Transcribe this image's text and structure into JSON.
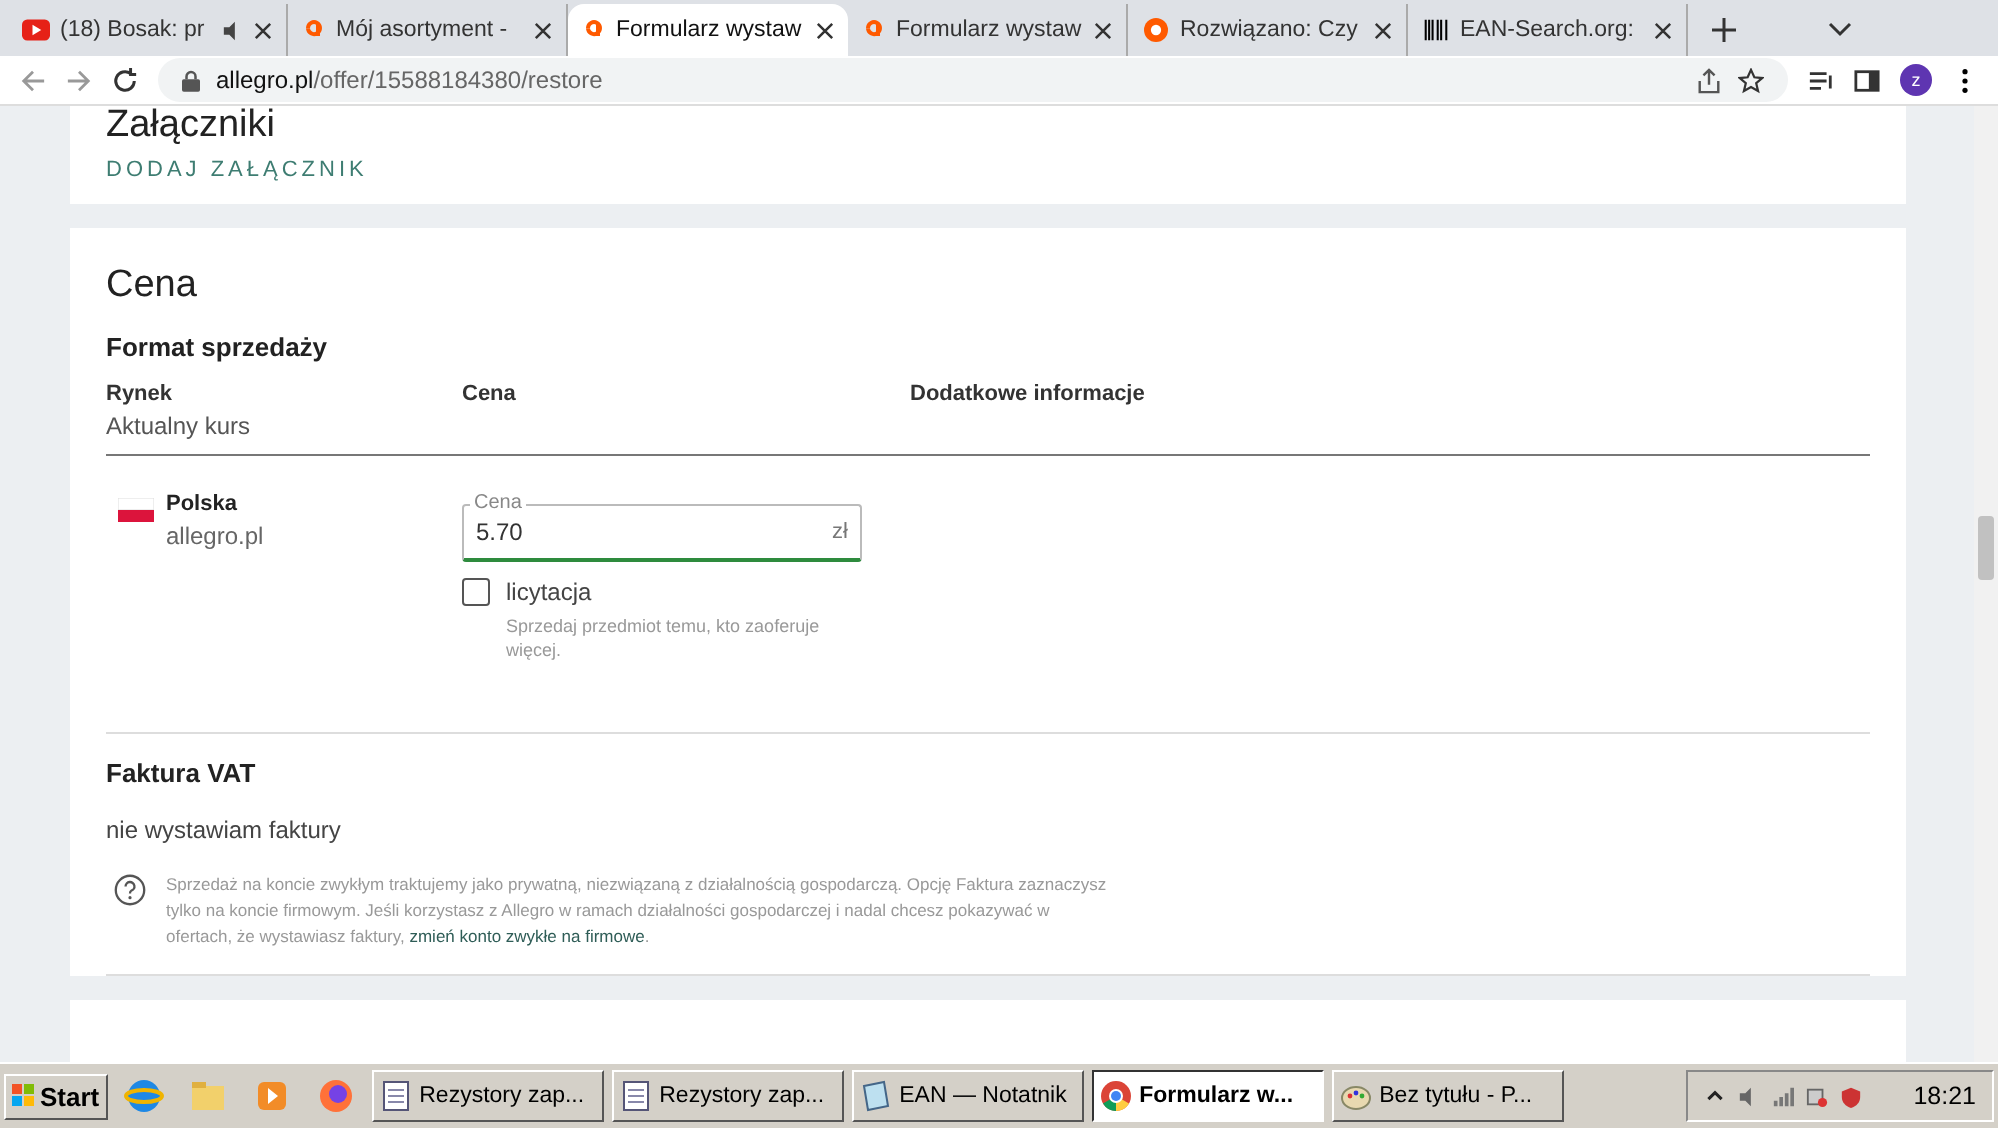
{
  "tabs": [
    {
      "title": "(18) Bosak: pr",
      "kind": "video",
      "muted": true,
      "selected": false
    },
    {
      "title": "Mój asortyment -",
      "kind": "store",
      "muted": false,
      "selected": false
    },
    {
      "title": "Formularz wystaw",
      "kind": "store",
      "muted": false,
      "selected": true
    },
    {
      "title": "Formularz wystaw",
      "kind": "store",
      "muted": false,
      "selected": false
    },
    {
      "title": "Rozwiązano: Czy",
      "kind": "forum",
      "muted": false,
      "selected": false
    },
    {
      "title": "EAN-Search.org:",
      "kind": "barcode",
      "muted": false,
      "selected": false
    }
  ],
  "address": {
    "host": "allegro.pl",
    "path": "/offer/15588184380/restore"
  },
  "profile": "z",
  "attachments": {
    "title": "Załączniki",
    "action": "DODAJ ZAŁĄCZNIK"
  },
  "price": {
    "title": "Cena",
    "subtitle": "Format sprzedaży",
    "columns": [
      "Rynek",
      "Cena",
      "Dodatkowe informacje"
    ],
    "column_note": "Aktualny kurs",
    "market": {
      "name": "Polska",
      "site": "allegro.pl"
    },
    "field": {
      "label": "Cena",
      "value": "5.70",
      "unit": "zł"
    },
    "auction": {
      "label": "licytacja",
      "checked": false,
      "hint": "Sprzedaj przedmiot temu, kto zaoferuje więcej."
    }
  },
  "invoice": {
    "title": "Faktura VAT",
    "value": "nie wystawiam faktury",
    "info": "Sprzedaż na koncie zwykłym traktujemy jako prywatną, niezwiązaną z działalnością gospodarczą. Opcję Faktura zaznaczysz tylko na koncie firmowym. Jeśli korzystasz z Allegro w ramach działalności gospodarczej i nadal chcesz pokazywać w ofertach, że wystawiasz faktury, ",
    "link": "zmień konto zwykłe na firmowe",
    "after": "."
  },
  "taskbar": {
    "start": "Start",
    "items": [
      {
        "label": "Rezystory zap...",
        "kind": "document",
        "selected": false
      },
      {
        "label": "Rezystory zap...",
        "kind": "document",
        "selected": false
      },
      {
        "label": "EAN — Notatnik",
        "kind": "editor",
        "selected": false
      },
      {
        "label": "Formularz w...",
        "kind": "browser",
        "selected": true
      },
      {
        "label": "Bez tytułu - P...",
        "kind": "paint",
        "selected": false
      }
    ],
    "clock": "18:21"
  }
}
